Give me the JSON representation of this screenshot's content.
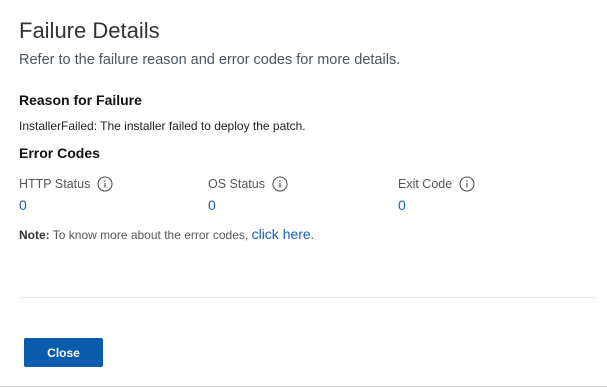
{
  "dialog": {
    "title": "Failure Details",
    "subtitle": "Refer to the failure reason and error codes for more details."
  },
  "reason": {
    "heading": "Reason for Failure",
    "text": "InstallerFailed: The installer failed to deploy the patch."
  },
  "error_codes": {
    "heading": "Error Codes",
    "items": [
      {
        "label": "HTTP Status",
        "value": "0",
        "icon": "info-icon"
      },
      {
        "label": "OS Status",
        "value": "0",
        "icon": "info-icon"
      },
      {
        "label": "Exit Code",
        "value": "0",
        "icon": "info-icon"
      }
    ]
  },
  "note": {
    "label": "Note:",
    "text": "To know more about the error codes,",
    "link_text": "click here",
    "suffix": "."
  },
  "footer": {
    "close_label": "Close"
  },
  "colors": {
    "accent": "#0b5cad",
    "link": "#1a5fb4",
    "divider": "#e6e6e6"
  }
}
